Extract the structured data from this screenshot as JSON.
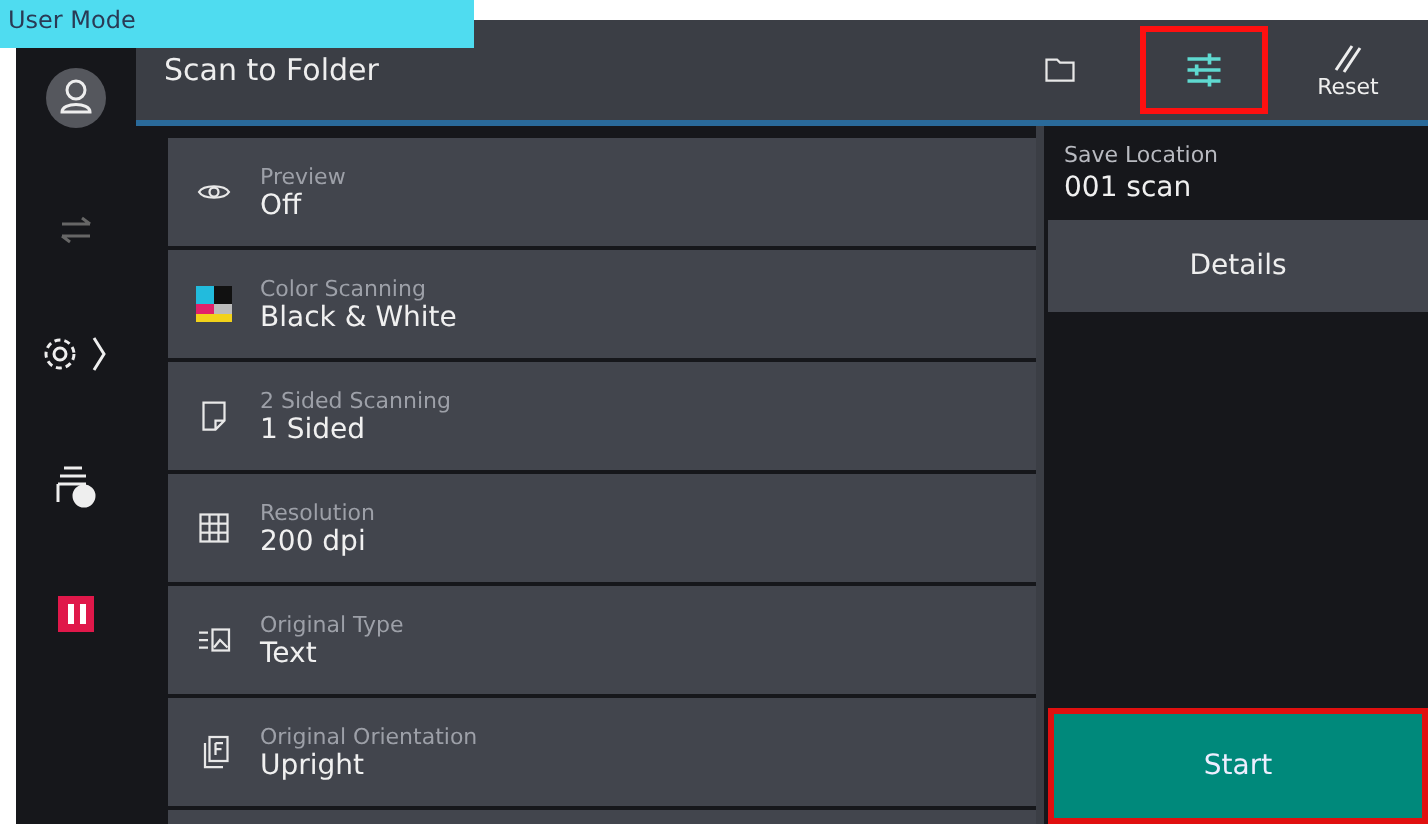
{
  "mode_banner": {
    "label": "User Mode"
  },
  "header": {
    "title": "Scan to Folder",
    "reset_label": "Reset",
    "settings_highlighted": true
  },
  "settings": [
    {
      "label": "Preview",
      "value": "Off"
    },
    {
      "label": "Color Scanning",
      "value": "Black & White"
    },
    {
      "label": "2 Sided Scanning",
      "value": "1 Sided"
    },
    {
      "label": "Resolution",
      "value": "200 dpi"
    },
    {
      "label": "Original Type",
      "value": "Text"
    },
    {
      "label": "Original Orientation",
      "value": "Upright"
    }
  ],
  "side_panel": {
    "save_location_label": "Save Location",
    "save_location_value": "001 scan",
    "details_label": "Details",
    "start_label": "Start",
    "start_highlighted": true
  }
}
